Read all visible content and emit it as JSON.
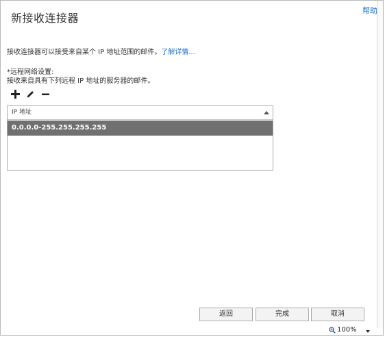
{
  "dialog": {
    "title": "新接收连接器",
    "help_label": "帮助"
  },
  "intro": {
    "text": "接收连接器可以接受来自某个 IP 地址范围的邮件。",
    "link": "了解详情..."
  },
  "remote_network": {
    "label": "*远程网络设置:",
    "sublabel": "接收来自具有下列远程 IP 地址的服务器的邮件。"
  },
  "toolbar": {
    "add_icon": "plus-icon",
    "edit_icon": "pencil-icon",
    "remove_icon": "minus-icon"
  },
  "grid": {
    "column_header": "IP 地址",
    "rows": [
      "0.0.0.0-255.255.255.255"
    ]
  },
  "buttons": {
    "back": "返回",
    "finish": "完成",
    "cancel": "取消"
  },
  "status": {
    "zoom": "100%"
  },
  "colors": {
    "link": "#1f6fc5",
    "selected_row": "#707070"
  }
}
